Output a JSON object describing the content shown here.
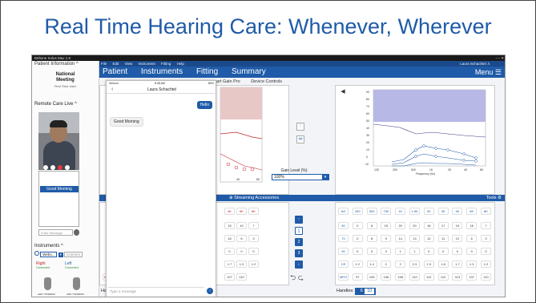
{
  "slide": {
    "title": "Real Time Hearing Care: Whenever, Wherever"
  },
  "app": {
    "window_title": "Beltone Solus Max 1.6",
    "window_controls": "– ▫ ✕",
    "menu": [
      "File",
      "Edit",
      "View",
      "Instrument",
      "Fitting",
      "Help"
    ],
    "user": "Laura Schachtel ♙",
    "tabs": [
      "Patient",
      "Instruments",
      "Fitting",
      "Summary"
    ],
    "menu_label": "Menu ☰",
    "subnav": [
      "art Gain Pro",
      "Device Controls"
    ]
  },
  "left_panel": {
    "patient_info": "Patient Information ^",
    "meeting_line1": "National",
    "meeting_line2": "Meeting",
    "meeting_sub": "First Time User",
    "remote_care": "Remote Care Live ^",
    "chat_message": "Good Morning",
    "enter_placeholder": "Enter Message",
    "instruments": "Instruments ^",
    "instr_select": "Webs...",
    "connect": "Connect",
    "right_label": "Right",
    "left_label": "Left",
    "connected": "Connected",
    "aid_label": "ADD 770/DRWC"
  },
  "phone": {
    "carrier": "Verizon",
    "time": "8:48 AM",
    "battery": "80%",
    "contact": "Laura Schachtel",
    "msg_sent": "Hello",
    "msg_received": "Good Morning",
    "input_placeholder": "Type a message"
  },
  "gain": {
    "label": "Gain Level (%)",
    "value": "100%"
  },
  "bluebar": {
    "streaming": "⊕  Streaming Accessories",
    "tools": "Tools ⚙"
  },
  "graph_right": {
    "x_ticks": [
      "125",
      "250",
      "500",
      "1K",
      "2K",
      "4K",
      "8K"
    ],
    "xlabel": "Frequency (Hz)",
    "y_ticks": [
      "90",
      "80",
      "70",
      "60",
      "50",
      "40",
      "30",
      "20",
      "10",
      "0",
      "-10"
    ]
  },
  "table_left": {
    "rows": [
      [
        "4K",
        "6K",
        "8K"
      ],
      [
        "15",
        "10",
        "7"
      ],
      [
        "16",
        "6",
        "3"
      ],
      [
        "0",
        "0",
        "0"
      ],
      [
        "1.7",
        "1.3",
        "1.2"
      ],
      [
        "MPO",
        "97",
        "105",
        "106",
        "108",
        "110",
        "112",
        "112",
        "113",
        "107",
        "110"
      ]
    ]
  },
  "table_right": {
    "header": [
      "AG",
      "250",
      "500",
      "750",
      "1K",
      "1.5K",
      "2K",
      "3K",
      "4K",
      "6K",
      "8K"
    ],
    "rows": [
      [
        "50",
        "0",
        "8",
        "15",
        "20",
        "20",
        "18",
        "17",
        "15",
        "16",
        "7"
      ],
      [
        "70",
        "0",
        "8",
        "9",
        "14",
        "14",
        "12",
        "11",
        "10",
        "6",
        "3"
      ],
      [
        "90",
        "0",
        "0",
        "0",
        "1",
        "1",
        "0",
        "0",
        "0",
        "0",
        "0"
      ],
      [
        "CR",
        "1.2",
        "1.4",
        "2",
        "2",
        "2.3",
        "1.9",
        "1.8",
        "1.7",
        "1.3",
        "1.2"
      ],
      [
        "MPO",
        "97",
        "105",
        "106",
        "108",
        "110",
        "112",
        "112",
        "113",
        "107",
        "110"
      ]
    ]
  },
  "channels": [
    "↑",
    "1",
    "2",
    "3",
    "↓"
  ],
  "handles": {
    "label": "Handles:",
    "a": "6",
    "b": "10"
  },
  "colors": {
    "brand_blue": "#1f5ba8",
    "right_red": "#c0262d",
    "left_blue": "#1f5ba8"
  }
}
